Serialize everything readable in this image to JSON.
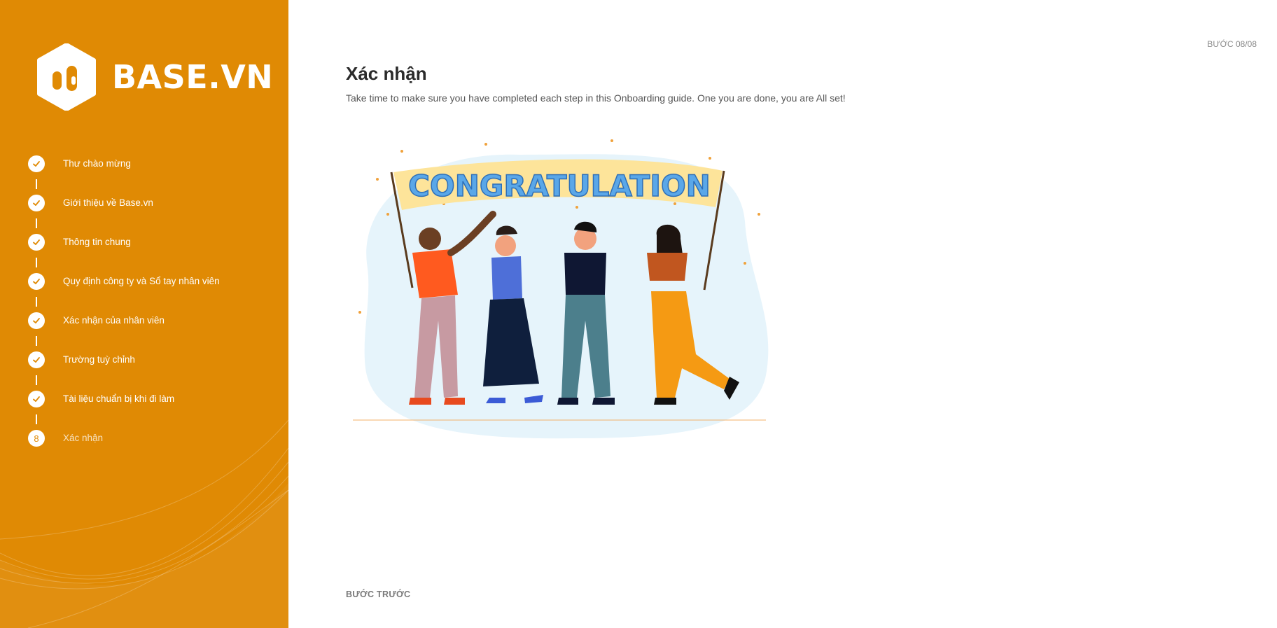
{
  "brand": {
    "name": "BASE.VN",
    "logo_icon": "base-logo-icon"
  },
  "sidebar": {
    "steps": [
      {
        "number": "1",
        "label": "Thư chào mừng",
        "status": "completed",
        "icon": "check-icon"
      },
      {
        "number": "2",
        "label": "Giới thiệu về Base.vn",
        "status": "completed",
        "icon": "check-icon"
      },
      {
        "number": "3",
        "label": "Thông tin chung",
        "status": "completed",
        "icon": "check-icon"
      },
      {
        "number": "4",
        "label": "Quy định công ty và Sổ tay nhân viên",
        "status": "completed",
        "icon": "check-icon"
      },
      {
        "number": "5",
        "label": "Xác nhận của nhân viên",
        "status": "completed",
        "icon": "check-icon"
      },
      {
        "number": "6",
        "label": "Trường tuỳ chỉnh",
        "status": "completed",
        "icon": "check-icon"
      },
      {
        "number": "7",
        "label": "Tài liệu chuẩn bị khi đi làm",
        "status": "completed",
        "icon": "check-icon"
      },
      {
        "number": "8",
        "label": "Xác nhận",
        "status": "current"
      }
    ]
  },
  "main": {
    "step_counter": "BƯỚC 08/08",
    "title": "Xác nhận",
    "subtitle": "Take time to make sure you have completed each step in this Onboarding guide. One you are done, you are All set!",
    "illustration": {
      "banner_text": "CONGRATULATION",
      "icon": "celebration-illustration"
    },
    "prev_button": "BƯỚC TRƯỚC"
  },
  "colors": {
    "accent": "#e08a04",
    "sidebar_text": "#ffffff",
    "title": "#2b2b2b",
    "muted": "#8c8c8c"
  }
}
